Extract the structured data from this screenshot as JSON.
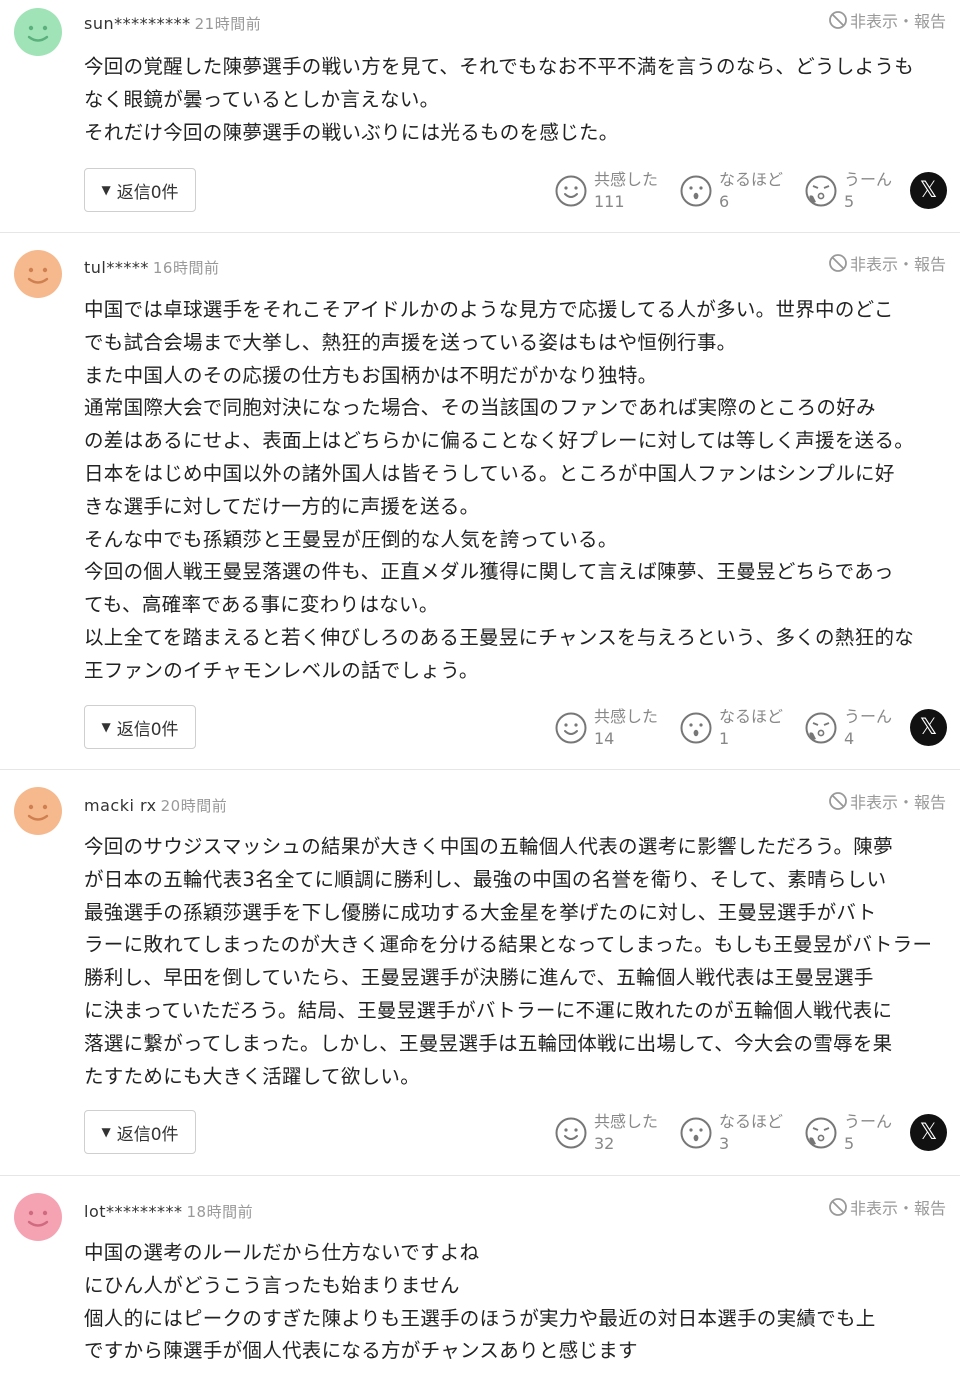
{
  "colors": {
    "avatar_green": "#9fe3b6",
    "avatar_orange": "#f5b98d",
    "avatar_pink": "#f5a3b3"
  },
  "labels": {
    "hide_report": "非表示・報告",
    "reply": "返信0件",
    "react_agree": "共感した",
    "react_understand": "なるほど",
    "react_hmm": "うーん",
    "share_icon": "x-logo"
  },
  "comments": [
    {
      "user": "sun*********",
      "time": "21時間前",
      "avatar_color": "green",
      "lines": [
        "今回の覚醒した陳夢選手の戦い方を見て、それでもなお不平不満を言うのなら、どうしようも",
        "なく眼鏡が曇っているとしか言えない。",
        "それだけ今回の陳夢選手の戦いぶりには光るものを感じた。"
      ],
      "counts": {
        "agree": "111",
        "understand": "6",
        "hmm": "5"
      }
    },
    {
      "user": "tul*****",
      "time": "16時間前",
      "avatar_color": "orange",
      "lines": [
        "中国では卓球選手をそれこそアイドルかのような見方で応援してる人が多い。世界中のどこ",
        "でも試合会場まで大挙し、熱狂的声援を送っている姿はもはや恒例行事。",
        "また中国人のその応援の仕方もお国柄かは不明だがかなり独特。",
        "通常国際大会で同胞対決になった場合、その当該国のファンであれば実際のところの好み",
        "の差はあるにせよ、表面上はどちらかに偏ることなく好プレーに対しては等しく声援を送る。",
        "日本をはじめ中国以外の諸外国人は皆そうしている。ところが中国人ファンはシンプルに好",
        "きな選手に対してだけ一方的に声援を送る。",
        "そんな中でも孫穎莎と王曼昱が圧倒的な人気を誇っている。",
        "今回の個人戦王曼昱落選の件も、正直メダル獲得に関して言えば陳夢、王曼昱どちらであっ",
        "ても、高確率である事に変わりはない。",
        "以上全てを踏まえると若く伸びしろのある王曼昱にチャンスを与えろという、多くの熱狂的な",
        "王ファンのイチャモンレベルの話でしょう。"
      ],
      "counts": {
        "agree": "14",
        "understand": "1",
        "hmm": "4"
      }
    },
    {
      "user": "macki rx",
      "time": "20時間前",
      "avatar_color": "orange",
      "lines": [
        "今回のサウジスマッシュの結果が大きく中国の五輪個人代表の選考に影響しただろう。陳夢",
        "が日本の五輪代表3名全てに順調に勝利し、最強の中国の名誉を衛り、そして、素晴らしい",
        "最強選手の孫穎莎選手を下し優勝に成功する大金星を挙げたのに対し、王曼昱選手がバト",
        "ラーに敗れてしまったのが大きく運命を分ける結果となってしまった。もしも王曼昱がバトラー",
        "勝利し、早田を倒していたら、王曼昱選手が決勝に進んで、五輪個人戦代表は王曼昱選手",
        "に決まっていただろう。結局、王曼昱選手がバトラーに不運に敗れたのが五輪個人戦代表に",
        "落選に繋がってしまった。しかし、王曼昱選手は五輪団体戦に出場して、今大会の雪辱を果",
        "たすためにも大きく活躍して欲しい。"
      ],
      "counts": {
        "agree": "32",
        "understand": "3",
        "hmm": "5"
      }
    },
    {
      "user": "lot*********",
      "time": "18時間前",
      "avatar_color": "pink",
      "lines": [
        "中国の選考のルールだから仕方ないですよね",
        "にひん人がどうこう言ったも始まりません",
        "個人的にはピークのすぎた陳よりも王選手のほうが実力や最近の対日本選手の実績でも上",
        "ですから陳選手が個人代表になる方がチャンスありと感じます"
      ]
    }
  ]
}
